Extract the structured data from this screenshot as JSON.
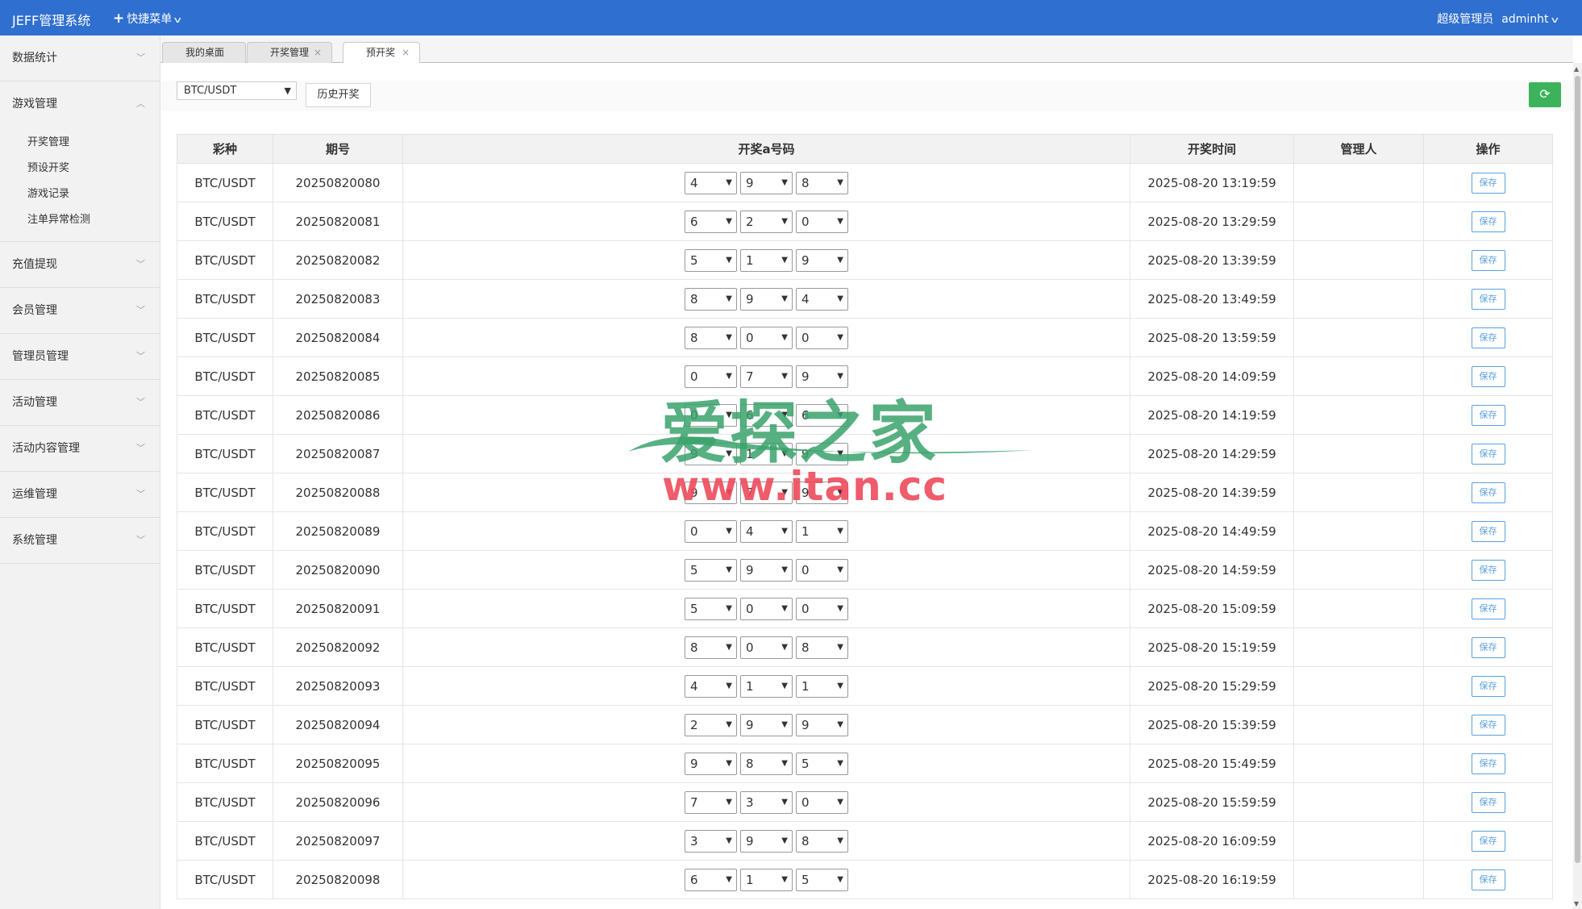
{
  "header": {
    "brand": "JEFF管理系统",
    "quick_menu": "快捷菜单",
    "role": "超级管理员",
    "username": "adminht"
  },
  "sidebar": {
    "groups": [
      {
        "label": "数据统计",
        "expanded": false
      },
      {
        "label": "游戏管理",
        "expanded": true,
        "items": [
          "开奖管理",
          "预设开奖",
          "游戏记录",
          "注单异常检测"
        ]
      },
      {
        "label": "充值提现",
        "expanded": false
      },
      {
        "label": "会员管理",
        "expanded": false
      },
      {
        "label": "管理员管理",
        "expanded": false
      },
      {
        "label": "活动管理",
        "expanded": false
      },
      {
        "label": "活动内容管理",
        "expanded": false
      },
      {
        "label": "运维管理",
        "expanded": false
      },
      {
        "label": "系统管理",
        "expanded": false
      }
    ]
  },
  "tabs": [
    {
      "label": "我的桌面",
      "closable": false,
      "active": false
    },
    {
      "label": "开奖管理",
      "closable": true,
      "active": false
    },
    {
      "label": "预开奖",
      "closable": true,
      "active": true
    }
  ],
  "toolbar": {
    "lottery_select": "BTC/USDT",
    "history_button": "历史开奖",
    "refresh_icon": "refresh-icon",
    "refresh_color": "#3cb35a"
  },
  "table": {
    "headers": [
      "彩种",
      "期号",
      "开奖a号码",
      "开奖时间",
      "管理人",
      "操作"
    ],
    "save_label": "保存",
    "rows": [
      {
        "lottery": "BTC/USDT",
        "issue": "20250820080",
        "n1": "4",
        "n2": "9",
        "n3": "8",
        "time": "2025-08-20 13:19:59",
        "admin": ""
      },
      {
        "lottery": "BTC/USDT",
        "issue": "20250820081",
        "n1": "6",
        "n2": "2",
        "n3": "0",
        "time": "2025-08-20 13:29:59",
        "admin": ""
      },
      {
        "lottery": "BTC/USDT",
        "issue": "20250820082",
        "n1": "5",
        "n2": "1",
        "n3": "9",
        "time": "2025-08-20 13:39:59",
        "admin": ""
      },
      {
        "lottery": "BTC/USDT",
        "issue": "20250820083",
        "n1": "8",
        "n2": "9",
        "n3": "4",
        "time": "2025-08-20 13:49:59",
        "admin": ""
      },
      {
        "lottery": "BTC/USDT",
        "issue": "20250820084",
        "n1": "8",
        "n2": "0",
        "n3": "0",
        "time": "2025-08-20 13:59:59",
        "admin": ""
      },
      {
        "lottery": "BTC/USDT",
        "issue": "20250820085",
        "n1": "0",
        "n2": "7",
        "n3": "9",
        "time": "2025-08-20 14:09:59",
        "admin": ""
      },
      {
        "lottery": "BTC/USDT",
        "issue": "20250820086",
        "n1": "0",
        "n2": "6",
        "n3": "6",
        "time": "2025-08-20 14:19:59",
        "admin": ""
      },
      {
        "lottery": "BTC/USDT",
        "issue": "20250820087",
        "n1": "9",
        "n2": "1",
        "n3": "9",
        "time": "2025-08-20 14:29:59",
        "admin": ""
      },
      {
        "lottery": "BTC/USDT",
        "issue": "20250820088",
        "n1": "9",
        "n2": "7",
        "n3": "9",
        "time": "2025-08-20 14:39:59",
        "admin": ""
      },
      {
        "lottery": "BTC/USDT",
        "issue": "20250820089",
        "n1": "0",
        "n2": "4",
        "n3": "1",
        "time": "2025-08-20 14:49:59",
        "admin": ""
      },
      {
        "lottery": "BTC/USDT",
        "issue": "20250820090",
        "n1": "5",
        "n2": "9",
        "n3": "0",
        "time": "2025-08-20 14:59:59",
        "admin": ""
      },
      {
        "lottery": "BTC/USDT",
        "issue": "20250820091",
        "n1": "5",
        "n2": "0",
        "n3": "0",
        "time": "2025-08-20 15:09:59",
        "admin": ""
      },
      {
        "lottery": "BTC/USDT",
        "issue": "20250820092",
        "n1": "8",
        "n2": "0",
        "n3": "8",
        "time": "2025-08-20 15:19:59",
        "admin": ""
      },
      {
        "lottery": "BTC/USDT",
        "issue": "20250820093",
        "n1": "4",
        "n2": "1",
        "n3": "1",
        "time": "2025-08-20 15:29:59",
        "admin": ""
      },
      {
        "lottery": "BTC/USDT",
        "issue": "20250820094",
        "n1": "2",
        "n2": "9",
        "n3": "9",
        "time": "2025-08-20 15:39:59",
        "admin": ""
      },
      {
        "lottery": "BTC/USDT",
        "issue": "20250820095",
        "n1": "9",
        "n2": "8",
        "n3": "5",
        "time": "2025-08-20 15:49:59",
        "admin": ""
      },
      {
        "lottery": "BTC/USDT",
        "issue": "20250820096",
        "n1": "7",
        "n2": "3",
        "n3": "0",
        "time": "2025-08-20 15:59:59",
        "admin": ""
      },
      {
        "lottery": "BTC/USDT",
        "issue": "20250820097",
        "n1": "3",
        "n2": "9",
        "n3": "8",
        "time": "2025-08-20 16:09:59",
        "admin": ""
      },
      {
        "lottery": "BTC/USDT",
        "issue": "20250820098",
        "n1": "6",
        "n2": "1",
        "n3": "5",
        "time": "2025-08-20 16:19:59",
        "admin": ""
      }
    ]
  },
  "watermark": {
    "title": "爱探之家",
    "url": "www.itan.cc"
  },
  "colors": {
    "header_bg": "#2f6fcf",
    "save_button": "#5aa0e0"
  }
}
